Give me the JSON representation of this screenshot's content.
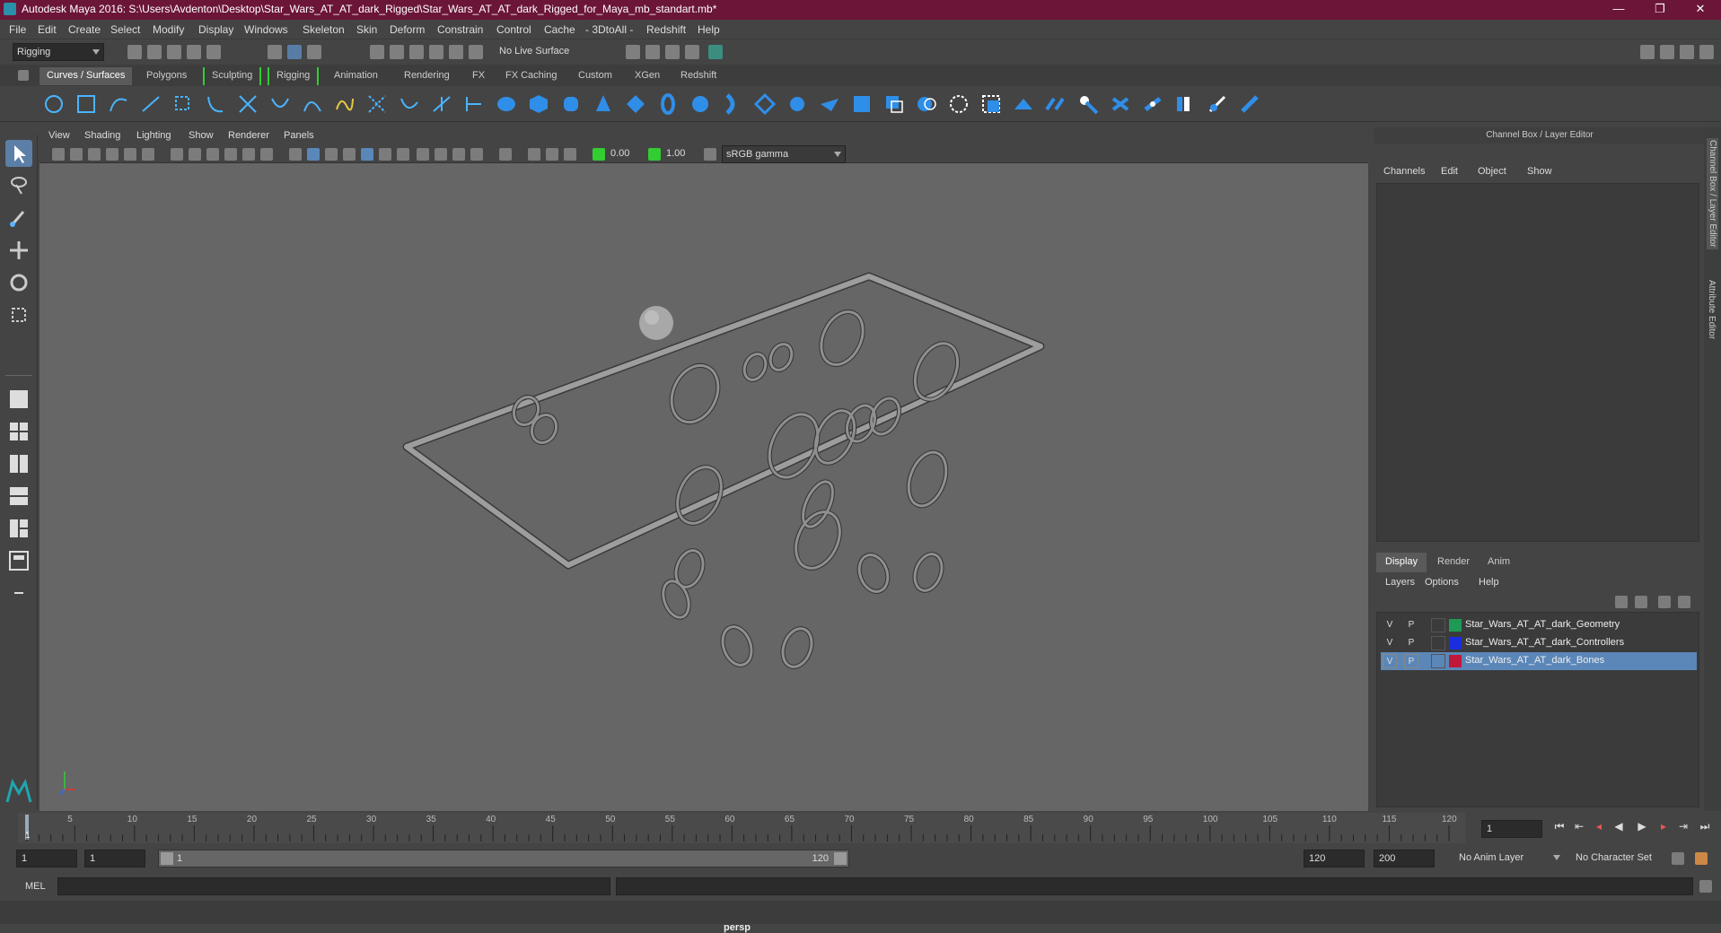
{
  "titlebar": {
    "title": "Autodesk Maya 2016: S:\\Users\\Avdenton\\Desktop\\Star_Wars_AT_AT_dark_Rigged\\Star_Wars_AT_AT_dark_Rigged_for_Maya_mb_standart.mb*",
    "min": "—",
    "max": "❐",
    "close": "✕"
  },
  "menubar": [
    "File",
    "Edit",
    "Create",
    "Select",
    "Modify",
    "Display",
    "Windows",
    "Skeleton",
    "Skin",
    "Deform",
    "Constrain",
    "Control",
    "Cache",
    "- 3DtoAll -",
    "Redshift",
    "Help"
  ],
  "statusline": {
    "mode": "Rigging",
    "live_surface": "No Live Surface"
  },
  "shelf_tabs": [
    "Curves / Surfaces",
    "Polygons",
    "Sculpting",
    "Rigging",
    "Animation",
    "Rendering",
    "FX",
    "FX Caching",
    "Custom",
    "XGen",
    "Redshift"
  ],
  "shelf_active": "Curves / Surfaces",
  "viewport": {
    "menu": [
      "View",
      "Shading",
      "Lighting",
      "Show",
      "Renderer",
      "Panels"
    ],
    "exposure": "0.00",
    "gamma": "1.00",
    "colorspace": "sRGB gamma",
    "camera_label": "persp"
  },
  "channel_box": {
    "header": "Channel Box / Layer Editor",
    "menu": [
      "Channels",
      "Edit",
      "Object",
      "Show"
    ]
  },
  "layer_editor": {
    "tabs": [
      "Display",
      "Render",
      "Anim"
    ],
    "active_tab": "Display",
    "menu": [
      "Layers",
      "Options",
      "Help"
    ],
    "layers": [
      {
        "v": "V",
        "p": "P",
        "name": "Star_Wars_AT_AT_dark_Geometry",
        "color": "#1f9a55",
        "selected": false
      },
      {
        "v": "V",
        "p": "P",
        "name": "Star_Wars_AT_AT_dark_Controllers",
        "color": "#1a2ee0",
        "selected": false
      },
      {
        "v": "V",
        "p": "P",
        "name": "Star_Wars_AT_AT_dark_Bones",
        "color": "#c0183a",
        "selected": true
      }
    ]
  },
  "side_tabs": [
    "Channel Box / Layer Editor",
    "Attribute Editor"
  ],
  "timeline": {
    "ticks": [
      "5",
      "10",
      "15",
      "20",
      "25",
      "30",
      "35",
      "40",
      "45",
      "50",
      "55",
      "60",
      "65",
      "70",
      "75",
      "80",
      "85",
      "90",
      "95",
      "100",
      "105",
      "110",
      "115",
      "120"
    ],
    "current_frame_label": "1",
    "current_frame_field": "1"
  },
  "range": {
    "start": "1",
    "start2": "1",
    "slider_start": "1",
    "slider_end": "120",
    "end": "120",
    "end2": "200",
    "anim_layer": "No Anim Layer",
    "char_set": "No Character Set"
  },
  "cmdline": {
    "label": "MEL"
  },
  "colors": {
    "title": "#6b1538",
    "selection": "#5b87b8",
    "viewport": "#666666"
  }
}
